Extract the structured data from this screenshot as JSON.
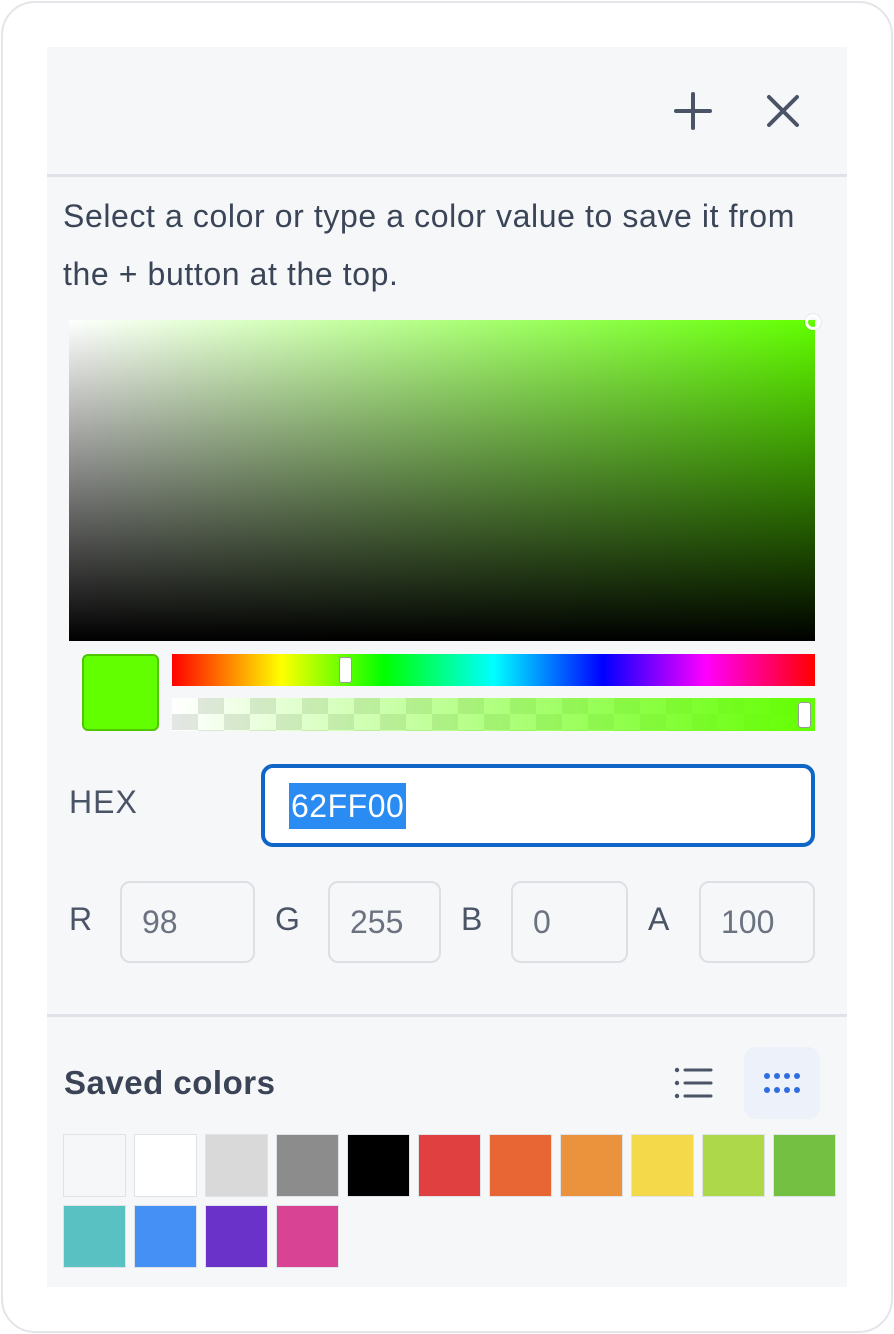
{
  "header": {
    "add_icon": "plus-icon",
    "close_icon": "close-icon"
  },
  "description": "Select a color or type a color value to save it from the + button at the top.",
  "current_color": "#62FF00",
  "hex": {
    "label": "HEX",
    "value": "62FF00"
  },
  "channels": [
    {
      "label": "R",
      "value": "98"
    },
    {
      "label": "G",
      "value": "255"
    },
    {
      "label": "B",
      "value": "0"
    },
    {
      "label": "A",
      "value": "100"
    }
  ],
  "saved_colors": {
    "title": "Saved colors",
    "list_view_icon": "list-icon",
    "grid_view_icon": "grid-dots-icon",
    "swatches": [
      "#f6f7f9",
      "#ffffff",
      "#d9d9d9",
      "#8c8c8c",
      "#000000",
      "#e04040",
      "#e86634",
      "#ea923c",
      "#f4da4a",
      "#acd84a",
      "#74c043",
      "#5ac1c3",
      "#4490f5",
      "#6a32c8",
      "#d94394"
    ]
  }
}
